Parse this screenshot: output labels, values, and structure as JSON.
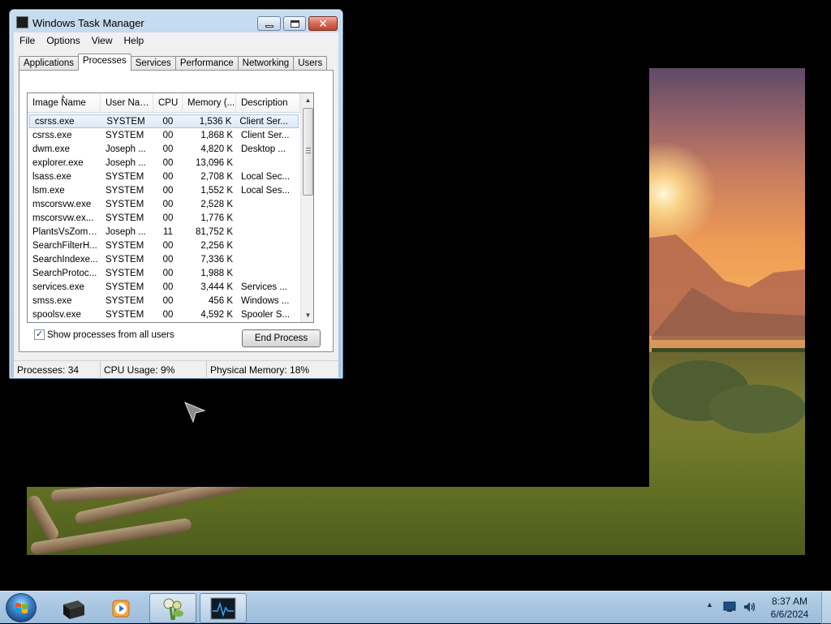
{
  "window": {
    "title": "Windows Task Manager",
    "menu": [
      "File",
      "Options",
      "View",
      "Help"
    ],
    "tabs": [
      "Applications",
      "Processes",
      "Services",
      "Performance",
      "Networking",
      "Users"
    ],
    "active_tab": "Processes",
    "columns": [
      "Image Name",
      "User Name",
      "CPU",
      "Memory (...",
      "Description"
    ],
    "processes": [
      {
        "name": "csrss.exe",
        "user": "SYSTEM",
        "cpu": "00",
        "mem": "1,536 K",
        "desc": "Client Ser..."
      },
      {
        "name": "csrss.exe",
        "user": "SYSTEM",
        "cpu": "00",
        "mem": "1,868 K",
        "desc": "Client Ser..."
      },
      {
        "name": "dwm.exe",
        "user": "Joseph ...",
        "cpu": "00",
        "mem": "4,820 K",
        "desc": "Desktop ..."
      },
      {
        "name": "explorer.exe",
        "user": "Joseph ...",
        "cpu": "00",
        "mem": "13,096 K",
        "desc": ""
      },
      {
        "name": "lsass.exe",
        "user": "SYSTEM",
        "cpu": "00",
        "mem": "2,708 K",
        "desc": "Local Sec..."
      },
      {
        "name": "lsm.exe",
        "user": "SYSTEM",
        "cpu": "00",
        "mem": "1,552 K",
        "desc": "Local Ses..."
      },
      {
        "name": "mscorsvw.exe",
        "user": "SYSTEM",
        "cpu": "00",
        "mem": "2,528 K",
        "desc": ""
      },
      {
        "name": "mscorsvw.ex...",
        "user": "SYSTEM",
        "cpu": "00",
        "mem": "1,776 K",
        "desc": ""
      },
      {
        "name": "PlantsVsZombi...",
        "user": "Joseph ...",
        "cpu": "11",
        "mem": "81,752 K",
        "desc": ""
      },
      {
        "name": "SearchFilterH...",
        "user": "SYSTEM",
        "cpu": "00",
        "mem": "2,256 K",
        "desc": ""
      },
      {
        "name": "SearchIndexe...",
        "user": "SYSTEM",
        "cpu": "00",
        "mem": "7,336 K",
        "desc": ""
      },
      {
        "name": "SearchProtoc...",
        "user": "SYSTEM",
        "cpu": "00",
        "mem": "1,988 K",
        "desc": ""
      },
      {
        "name": "services.exe",
        "user": "SYSTEM",
        "cpu": "00",
        "mem": "3,444 K",
        "desc": "Services ..."
      },
      {
        "name": "smss.exe",
        "user": "SYSTEM",
        "cpu": "00",
        "mem": "456 K",
        "desc": "Windows ..."
      },
      {
        "name": "spoolsv.exe",
        "user": "SYSTEM",
        "cpu": "00",
        "mem": "4,592 K",
        "desc": "Spooler S..."
      }
    ],
    "show_all_label": "Show processes from all users",
    "show_all_checked": true,
    "end_process_label": "End Process",
    "status": {
      "processes": "Processes: 34",
      "cpu": "CPU Usage: 9%",
      "memory": "Physical Memory: 18%"
    }
  },
  "taskbar": {
    "items": [
      {
        "icon": "black-box-app-icon",
        "active": false
      },
      {
        "icon": "media-player-icon",
        "active": false
      },
      {
        "icon": "plants-vs-zombies-icon",
        "active": true
      },
      {
        "icon": "task-manager-icon",
        "active": true
      }
    ],
    "tray_icons": [
      "show-hidden-icons-arrow",
      "network-icon",
      "volume-icon"
    ],
    "time": "8:37 AM",
    "date": "6/6/2024"
  },
  "colors": {
    "selection": "#dde9f7",
    "taskbar": "#a9c7e2",
    "window_frame": "#b9d1e9"
  }
}
